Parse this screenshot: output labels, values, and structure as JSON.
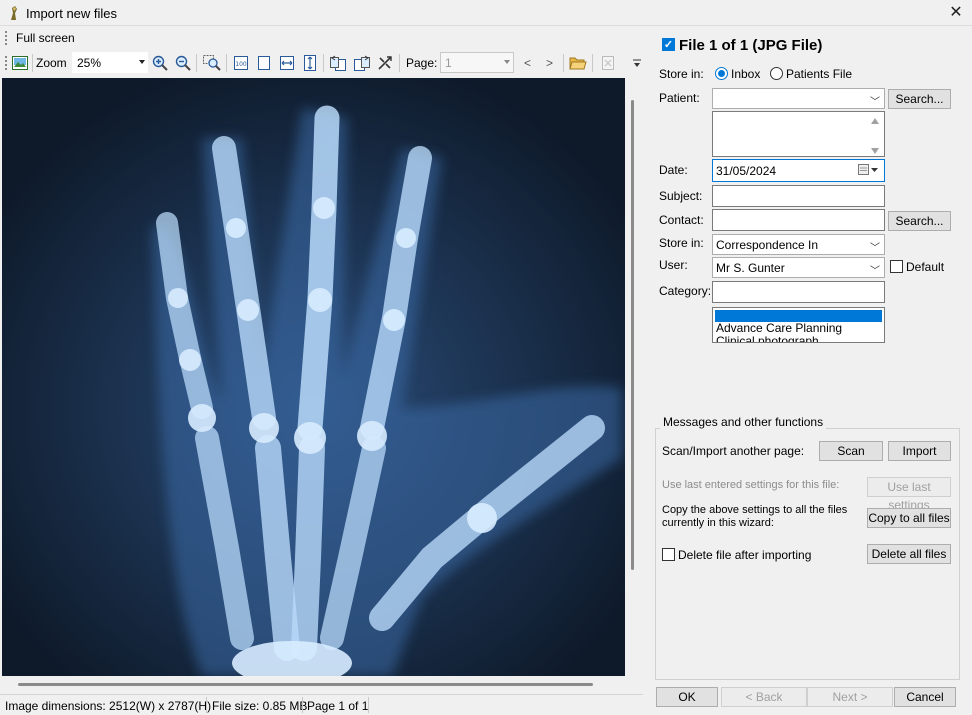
{
  "window": {
    "title": "Import new files"
  },
  "viewer": {
    "full_screen_label": "Full screen",
    "zoom_label": "Zoom",
    "zoom_value": "25%",
    "page_label": "Page:",
    "page_value": "1",
    "prev_label": "<",
    "next_label": ">"
  },
  "status": {
    "dimensions": "Image dimensions: 2512(W) x 2787(H)",
    "file_size": "File size: 0.85 MB",
    "page": "Page 1 of 1"
  },
  "form": {
    "header": "File 1 of 1 (JPG File)",
    "store_in_label": "Store in:",
    "store_option_inbox": "Inbox",
    "store_option_patients": "Patients File",
    "patient_label": "Patient:",
    "patient_value": "",
    "search_label": "Search...",
    "date_label": "Date:",
    "date_value": "31/05/2024",
    "subject_label": "Subject:",
    "subject_value": "",
    "contact_label": "Contact:",
    "contact_value": "",
    "contact_search_label": "Search...",
    "store_in2_label": "Store in:",
    "store_in2_value": "Correspondence In",
    "user_label": "User:",
    "user_value": "Mr S. Gunter",
    "default_label": "Default",
    "category_label": "Category:",
    "category_value": "",
    "category_options": [
      "",
      "Advance Care Planning",
      "Clinical photograph"
    ]
  },
  "messages": {
    "group_title": "Messages and other functions",
    "scan_import_label": "Scan/Import another page:",
    "scan_button": "Scan",
    "import_button": "Import",
    "use_last_label": "Use last entered settings for this file:",
    "use_last_button": "Use last settings",
    "copy_label_line1": "Copy the above settings to all the files",
    "copy_label_line2": "currently in this wizard:",
    "copy_button": "Copy to all files",
    "delete_after_label": "Delete file after importing",
    "delete_all_button": "Delete all files"
  },
  "footer": {
    "ok": "OK",
    "back": "< Back",
    "next": "Next >",
    "cancel": "Cancel"
  },
  "colors": {
    "accent": "#0078d7",
    "xray_background": "#0e1a2a",
    "xray_bone": "#bfe0ff"
  }
}
